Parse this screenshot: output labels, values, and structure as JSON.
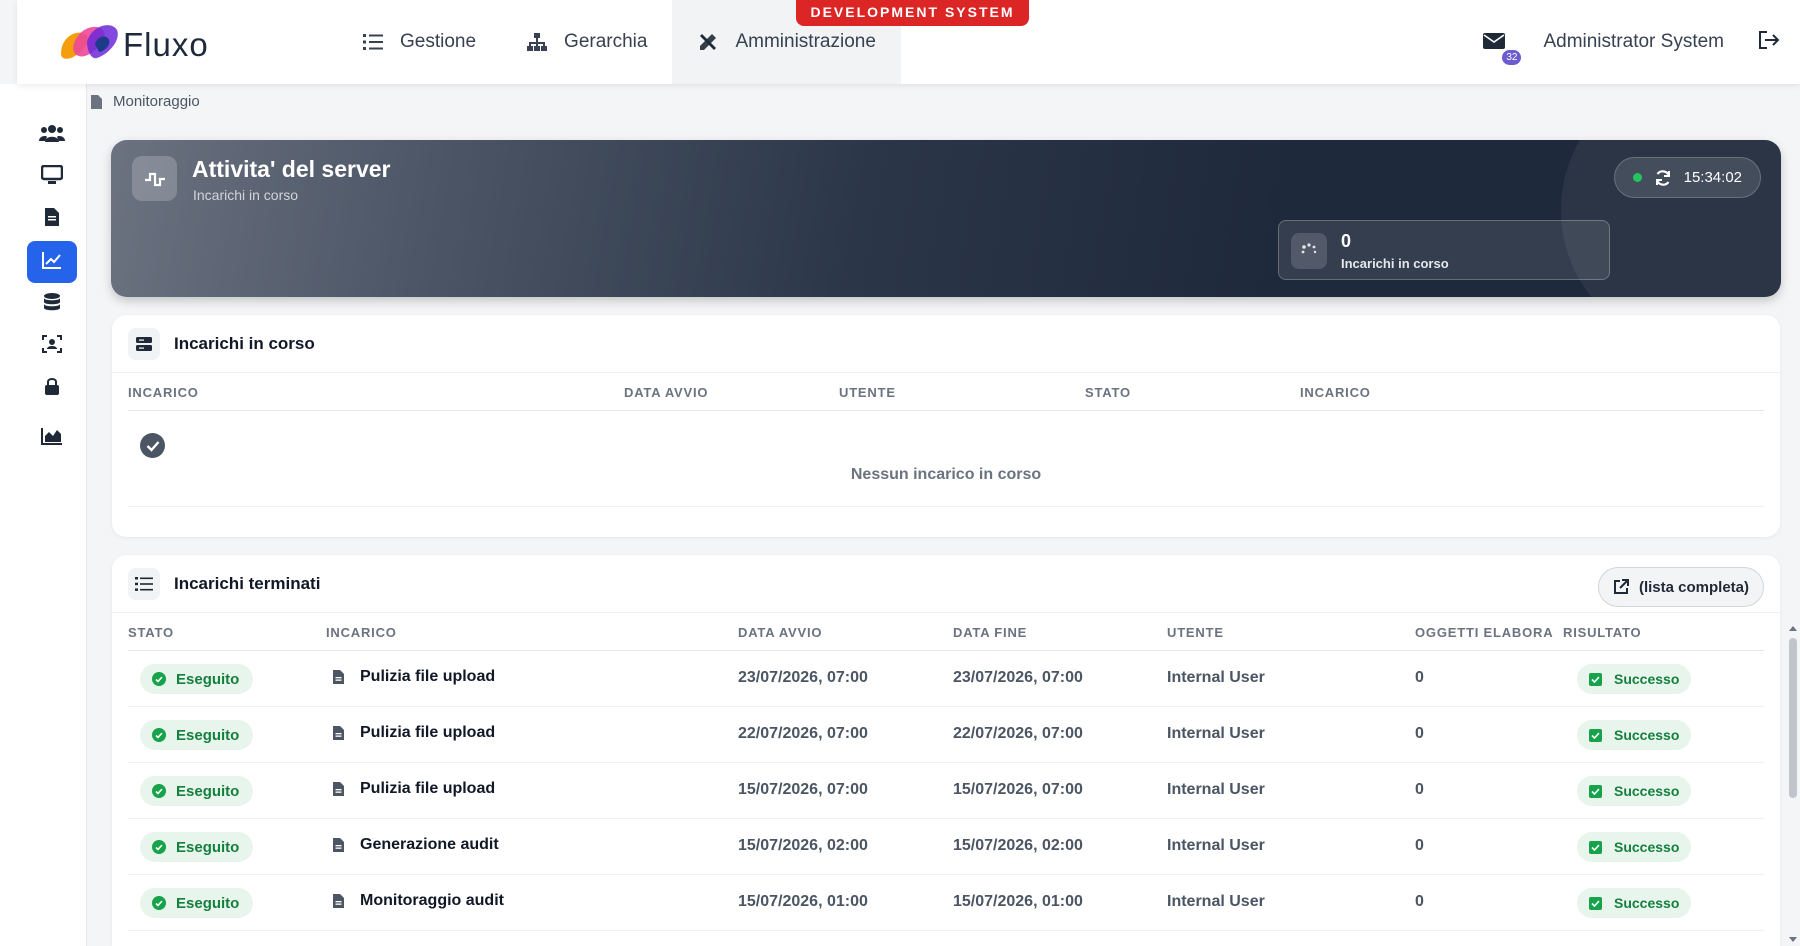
{
  "app": {
    "brand": "Fluxo",
    "env_banner": "DEVELOPMENT SYSTEM",
    "colors": {
      "accent": "#2563eb",
      "danger": "#dc2626",
      "success": "#16a34a",
      "hero_dark": "#1e293b"
    }
  },
  "nav": {
    "items": [
      {
        "label": "Gestione",
        "icon": "list-icon"
      },
      {
        "label": "Gerarchia",
        "icon": "hierarchy-icon"
      },
      {
        "label": "Amministrazione",
        "icon": "tools-icon",
        "active": true
      }
    ]
  },
  "user": {
    "name": "Administrator System",
    "unread_count": "32"
  },
  "sidebar": {
    "items": [
      {
        "icon": "users-icon"
      },
      {
        "icon": "monitor-icon"
      },
      {
        "icon": "file-icon"
      },
      {
        "icon": "chart-line-icon",
        "active": true
      },
      {
        "icon": "database-icon"
      },
      {
        "icon": "face-scan-icon"
      },
      {
        "icon": "lock-icon"
      },
      {
        "icon": "chart-area-icon"
      }
    ]
  },
  "breadcrumb": {
    "label": "Monitoraggio"
  },
  "hero": {
    "title": "Attivita' del server",
    "subtitle": "Incarichi in corso",
    "time": "15:34:02",
    "stat_value": "0",
    "stat_label": "Incarichi in corso"
  },
  "running": {
    "title": "Incarichi in corso",
    "columns": [
      "INCARICO",
      "DATA AVVIO",
      "UTENTE",
      "STATO",
      "INCARICO"
    ],
    "empty_message": "Nessun incarico in corso"
  },
  "finished": {
    "title": "Incarichi terminati",
    "full_list_label": "(lista completa)",
    "columns": [
      "STATO",
      "INCARICO",
      "DATA AVVIO",
      "DATA FINE",
      "UTENTE",
      "OGGETTI ELABORA",
      "RISULTATO"
    ],
    "rows": [
      {
        "status": "Eseguito",
        "task": "Pulizia file upload",
        "start": "23/07/2026, 07:00",
        "end": "23/07/2026, 07:00",
        "user": "Internal User",
        "objects": "0",
        "result": "Successo"
      },
      {
        "status": "Eseguito",
        "task": "Pulizia file upload",
        "start": "22/07/2026, 07:00",
        "end": "22/07/2026, 07:00",
        "user": "Internal User",
        "objects": "0",
        "result": "Successo"
      },
      {
        "status": "Eseguito",
        "task": "Pulizia file upload",
        "start": "15/07/2026, 07:00",
        "end": "15/07/2026, 07:00",
        "user": "Internal User",
        "objects": "0",
        "result": "Successo"
      },
      {
        "status": "Eseguito",
        "task": "Generazione audit",
        "start": "15/07/2026, 02:00",
        "end": "15/07/2026, 02:00",
        "user": "Internal User",
        "objects": "0",
        "result": "Successo"
      },
      {
        "status": "Eseguito",
        "task": "Monitoraggio audit",
        "start": "15/07/2026, 01:00",
        "end": "15/07/2026, 01:00",
        "user": "Internal User",
        "objects": "0",
        "result": "Successo"
      }
    ]
  }
}
